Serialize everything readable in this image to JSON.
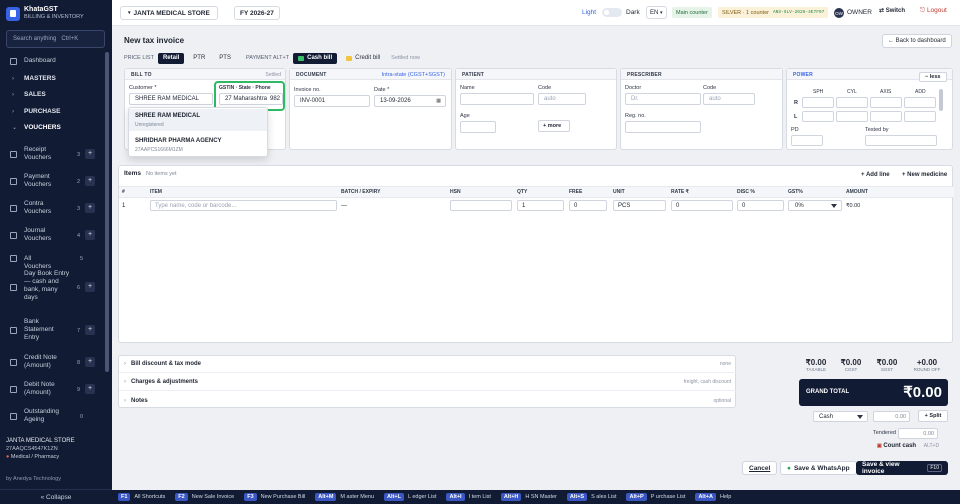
{
  "brand": {
    "name": "KhataGST",
    "subtitle": "BILLING & INVENTORY"
  },
  "sidebar": {
    "search_placeholder": "Search anything",
    "search_shortcut": "Ctrl+K",
    "items": [
      {
        "label": "Dashboard",
        "icon": "dashboard-icon"
      },
      {
        "label": "MASTERS",
        "group": true
      },
      {
        "label": "SALES",
        "group": true
      },
      {
        "label": "PURCHASE",
        "group": true
      },
      {
        "label": "VOUCHERS",
        "group": true,
        "active": true
      }
    ],
    "vouchers": [
      {
        "label": "Receipt Vouchers",
        "count": "3"
      },
      {
        "label": "Payment Vouchers",
        "count": "2"
      },
      {
        "label": "Contra Vouchers",
        "count": "3"
      },
      {
        "label": "Journal Vouchers",
        "count": "4"
      },
      {
        "label": "All Vouchers",
        "count": "5"
      },
      {
        "label": "Day Book Entry — cash and bank, many days",
        "count": "6"
      },
      {
        "label": "Bank Statement Entry",
        "count": "7"
      },
      {
        "label": "Credit Note (Amount)",
        "count": "8"
      },
      {
        "label": "Debit Note (Amount)",
        "count": "9"
      },
      {
        "label": "Outstanding Ageing",
        "count": "0"
      }
    ],
    "store_name": "JANTA MEDICAL STORE",
    "store_gstin": "27AAQCS4547K1ZN",
    "store_category": "Medical / Pharmacy",
    "by": "by Anedya Technology",
    "collapse": "« Collapse"
  },
  "topbar": {
    "store": "JANTA MEDICAL STORE",
    "fy": "FY 2026-27",
    "light": "Light",
    "dark": "Dark",
    "lang": "EN",
    "counter": "Main counter",
    "plan": "SILVER · 1 counter",
    "plan_code": "ANS-SLV-2026-4E7F97",
    "avatar": "OW",
    "owner": "OWNER",
    "switch": "⇄ Switch",
    "logout": "⎋ Logout"
  },
  "invoice": {
    "title": "New tax invoice",
    "back": "← Back to dashboard",
    "price_list_label": "PRICE LIST",
    "price_lists": [
      "Retail",
      "PTR",
      "PTS"
    ],
    "payment_label": "PAYMENT ALT+T",
    "cash_bill": "Cash bill",
    "credit_bill": "Credit bill",
    "settled": "Settled now"
  },
  "bill_to": {
    "header": "BILL TO",
    "status": "Settled",
    "customer_label": "Customer *",
    "customer_value": "SHREE RAM MEDICAL",
    "gstin_label": "GSTIN · State · Phone",
    "gstin_value": "27 Maharashtra",
    "phone_partial": "982",
    "options": [
      {
        "name": "SHREE RAM MEDICAL",
        "sub": "Unregistered"
      },
      {
        "name": "SHRIDHAR PHARMA AGENCY",
        "sub": "27AAPCS1666M1ZM"
      }
    ]
  },
  "document": {
    "header": "DOCUMENT",
    "tax_type": "Intra-state (CGST+SGST)",
    "invoice_label": "Invoice no.",
    "invoice_value": "INV-0001",
    "date_label": "Date *",
    "date_value": "13-09-2026"
  },
  "patient": {
    "header": "PATIENT",
    "name_label": "Name",
    "code_label": "Code",
    "code_placeholder": "auto",
    "age_label": "Age",
    "more": "+ more"
  },
  "prescriber": {
    "header": "PRESCRIBER",
    "doctor_label": "Doctor",
    "doctor_placeholder": "Dr.",
    "code_label": "Code",
    "code_placeholder": "auto",
    "reg_label": "Reg. no."
  },
  "power": {
    "header": "POWER",
    "less": "− less",
    "cols": [
      "SPH",
      "CYL",
      "AXIS",
      "ADD"
    ],
    "rows": [
      "R",
      "L"
    ],
    "pd": "PD",
    "tested": "Tested by"
  },
  "items": {
    "title": "Items",
    "empty": "No items yet",
    "add_line": "+ Add line",
    "new_medicine": "+ New medicine",
    "columns": [
      "#",
      "ITEM",
      "BATCH / EXPIRY",
      "HSN",
      "QTY",
      "FREE",
      "UNIT",
      "RATE ₹",
      "DISC %",
      "GST%",
      "AMOUNT"
    ],
    "row": {
      "n": "1",
      "item_placeholder": "Type name, code or barcode...",
      "batch": "—",
      "qty": "1",
      "free": "0",
      "unit": "PCS",
      "rate": "0",
      "disc": "0",
      "gst": "0%",
      "amount": "₹0.00"
    }
  },
  "extras": [
    {
      "label": "Bill discount & tax mode",
      "hint": "none"
    },
    {
      "label": "Charges & adjustments",
      "hint": "freight, cash discount"
    },
    {
      "label": "Notes",
      "hint": "optional"
    }
  ],
  "totals": [
    {
      "value": "₹0.00",
      "label": "TAXABLE"
    },
    {
      "value": "₹0.00",
      "label": "CGST"
    },
    {
      "value": "₹0.00",
      "label": "SGST"
    },
    {
      "value": "+0.00",
      "label": "ROUND OFF"
    }
  ],
  "grand_total": {
    "label": "GRAND TOTAL",
    "value": "₹0.00"
  },
  "payment": {
    "mode": "Cash",
    "amount": "0.00",
    "split": "+ Split",
    "tendered_label": "Tendered",
    "tendered": "0.00",
    "count_cash": "Count cash",
    "count_key": "ALT+D"
  },
  "actions": {
    "cancel": "Cancel",
    "save_whatsapp": "Save & WhatsApp",
    "save_view": "Save & view invoice",
    "save_key": "F10"
  },
  "shortcuts": [
    {
      "key": "F1",
      "label": "All Shortcuts"
    },
    {
      "key": "F2",
      "label": "New Sale Invoice"
    },
    {
      "key": "F3",
      "label": "New Purchase Bill"
    },
    {
      "key": "Alt+M",
      "label": "M aster Menu"
    },
    {
      "key": "Alt+L",
      "label": "L edger List"
    },
    {
      "key": "Alt+I",
      "label": "I tem List"
    },
    {
      "key": "Alt+H",
      "label": "H SN Master"
    },
    {
      "key": "Alt+S",
      "label": "S ales List"
    },
    {
      "key": "Alt+P",
      "label": "P urchase List"
    },
    {
      "key": "Alt+A",
      "label": "Help"
    }
  ],
  "colors": {
    "sidebar_bg": "#111b33",
    "accent": "#3763e6",
    "highlight": "#2fb965",
    "logout": "#c0392b"
  }
}
